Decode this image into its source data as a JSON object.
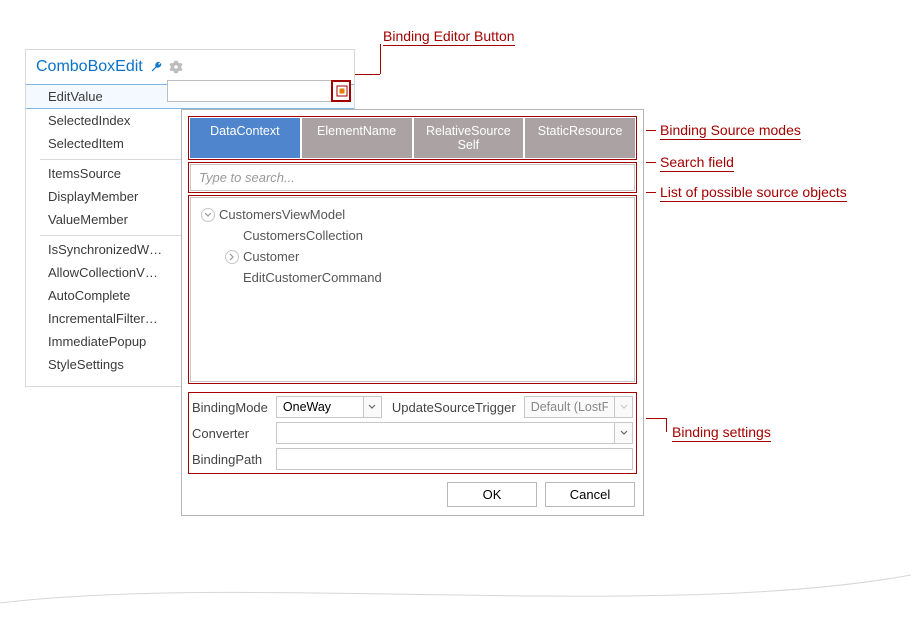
{
  "annotations": {
    "binding_button": "Binding Editor Button",
    "source_modes": "Binding Source modes",
    "search_field": "Search field",
    "source_list": "List of possible source objects",
    "settings": "Binding settings"
  },
  "panel": {
    "title": "ComboBoxEdit",
    "groups": [
      [
        "EditValue",
        "SelectedIndex",
        "SelectedItem"
      ],
      [
        "ItemsSource",
        "DisplayMember",
        "ValueMember"
      ],
      [
        "IsSynchronizedW…",
        "AllowCollectionV…",
        "AutoComplete",
        "IncrementalFilter…",
        "ImmediatePopup",
        "StyleSettings"
      ]
    ],
    "selected": "EditValue"
  },
  "popup": {
    "tabs": [
      "DataContext",
      "ElementName",
      "RelativeSource Self",
      "StaticResource"
    ],
    "active_tab": 0,
    "search_placeholder": "Type to search...",
    "tree": [
      {
        "level": 0,
        "expander": "down",
        "label": "CustomersViewModel"
      },
      {
        "level": 1,
        "expander": "",
        "label": "CustomersCollection"
      },
      {
        "level": 1,
        "expander": "right",
        "label": "Customer"
      },
      {
        "level": 1,
        "expander": "",
        "label": "EditCustomerCommand"
      }
    ],
    "settings": {
      "binding_mode_label": "BindingMode",
      "binding_mode_value": "OneWay",
      "ust_label": "UpdateSourceTrigger",
      "ust_value": "Default (LostFocus)",
      "converter_label": "Converter",
      "converter_value": "",
      "binding_path_label": "BindingPath",
      "binding_path_value": ""
    },
    "ok": "OK",
    "cancel": "Cancel"
  }
}
